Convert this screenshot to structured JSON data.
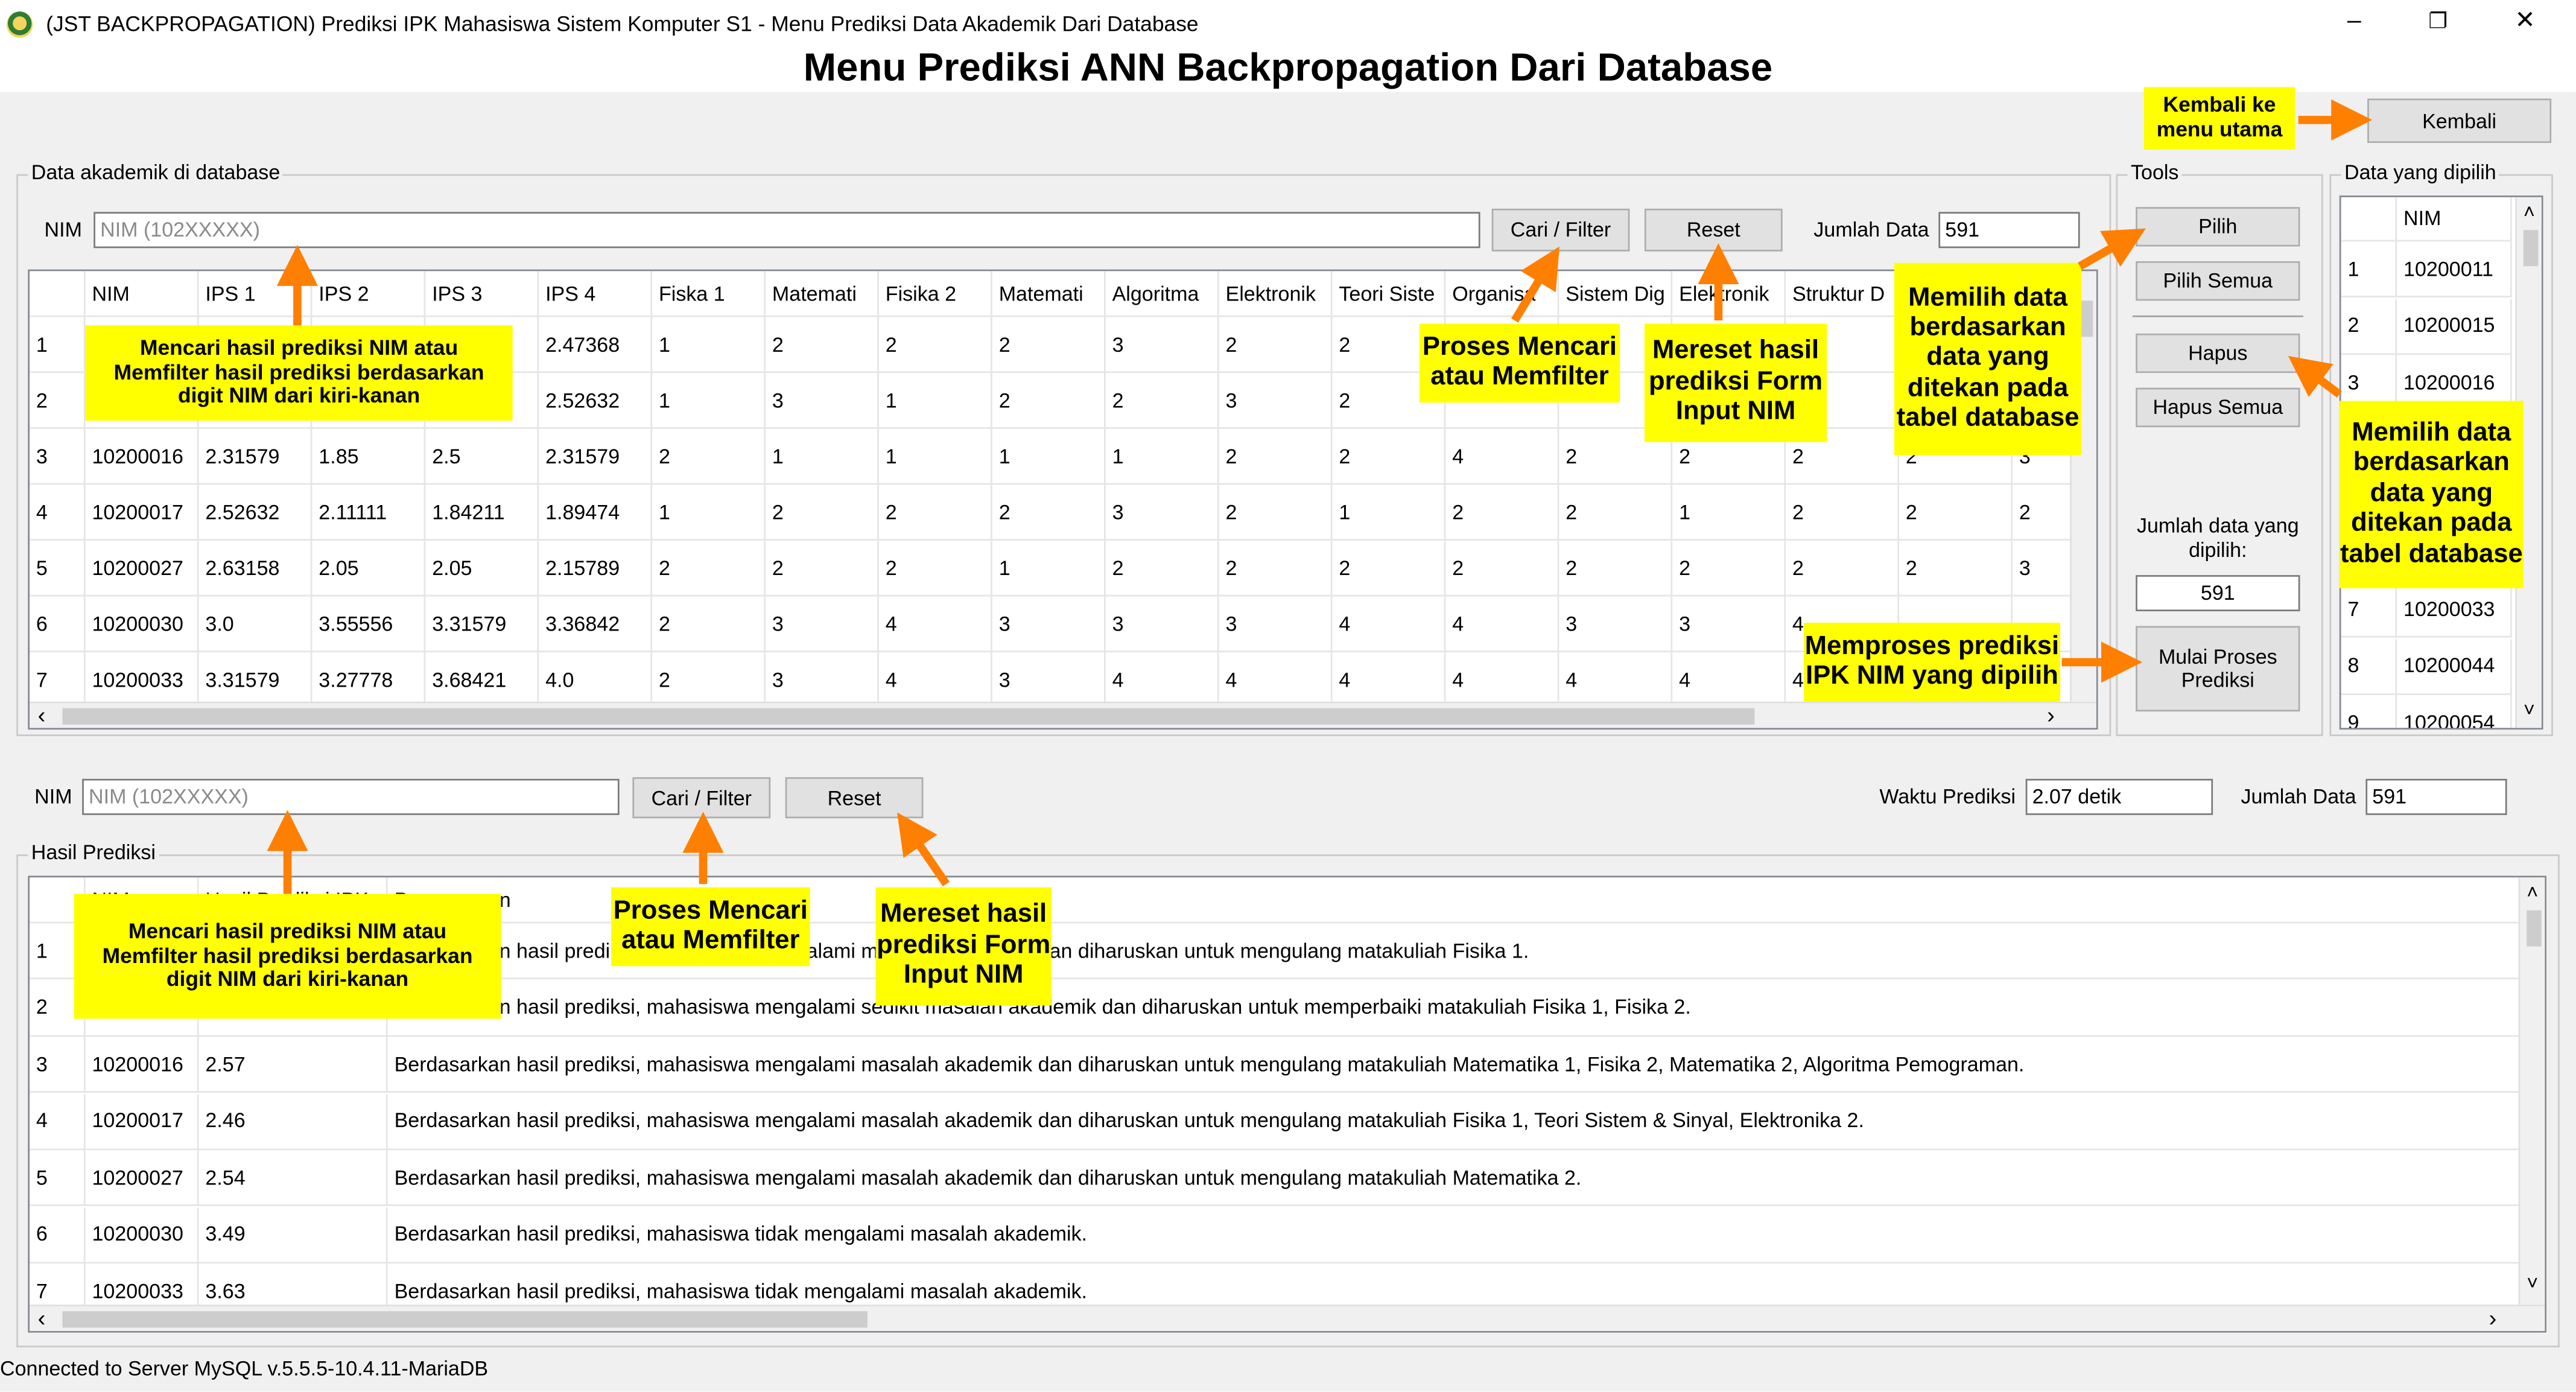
{
  "window": {
    "title": "(JST BACKPROPAGATION) Prediksi IPK Mahasiswa Sistem Komputer S1 - Menu Prediksi Data Akademik Dari Database",
    "minimize": "–",
    "maximize": "❐",
    "close": "✕"
  },
  "heading": "Menu Prediksi ANN Backpropagation Dari Database",
  "kembali": "Kembali",
  "top_panel": {
    "group_label": "Data akademik di database",
    "nim_label": "NIM",
    "nim_placeholder": "NIM (102XXXXX)",
    "search_button": "Cari / Filter",
    "reset_button": "Reset",
    "jumlah_label": "Jumlah Data",
    "jumlah_value": "591",
    "columns": [
      "NIM",
      "IPS 1",
      "IPS 2",
      "IPS 3",
      "IPS 4",
      "Fiska 1",
      "Matemati",
      "Fisika 2",
      "Matemati",
      "Algoritma",
      "Elektronik",
      "Teori Siste",
      "Organisa",
      "Sistem Dig",
      "Elektronik",
      "Struktur D",
      "",
      ""
    ],
    "rows": [
      {
        "idx": "1",
        "cells": [
          "",
          "",
          "",
          "",
          "2.47368",
          "1",
          "2",
          "2",
          "2",
          "3",
          "2",
          "2",
          "",
          "",
          "",
          "",
          "",
          ""
        ]
      },
      {
        "idx": "2",
        "cells": [
          "",
          "",
          "",
          "",
          "2.52632",
          "1",
          "3",
          "1",
          "2",
          "2",
          "3",
          "2",
          "",
          "",
          "",
          "",
          "",
          ""
        ]
      },
      {
        "idx": "3",
        "cells": [
          "10200016",
          "2.31579",
          "1.85",
          "2.5",
          "2.31579",
          "2",
          "1",
          "1",
          "1",
          "1",
          "2",
          "2",
          "4",
          "2",
          "2",
          "2",
          "2",
          "3"
        ]
      },
      {
        "idx": "4",
        "cells": [
          "10200017",
          "2.52632",
          "2.11111",
          "1.84211",
          "1.89474",
          "1",
          "2",
          "2",
          "2",
          "3",
          "2",
          "1",
          "2",
          "2",
          "1",
          "2",
          "2",
          "2"
        ]
      },
      {
        "idx": "5",
        "cells": [
          "10200027",
          "2.63158",
          "2.05",
          "2.05",
          "2.15789",
          "2",
          "2",
          "2",
          "1",
          "2",
          "2",
          "2",
          "2",
          "2",
          "2",
          "2",
          "2",
          "3"
        ]
      },
      {
        "idx": "6",
        "cells": [
          "10200030",
          "3.0",
          "3.55556",
          "3.31579",
          "3.36842",
          "2",
          "3",
          "4",
          "3",
          "3",
          "3",
          "4",
          "4",
          "3",
          "3",
          "4",
          "",
          ""
        ]
      },
      {
        "idx": "7",
        "cells": [
          "10200033",
          "3.31579",
          "3.27778",
          "3.68421",
          "4.0",
          "2",
          "3",
          "4",
          "3",
          "4",
          "4",
          "4",
          "4",
          "4",
          "4",
          "4",
          "",
          ""
        ]
      }
    ]
  },
  "tools": {
    "group_label": "Tools",
    "pilih": "Pilih",
    "pilih_semua": "Pilih Semua",
    "hapus": "Hapus",
    "hapus_semua": "Hapus Semua",
    "jumlah_label": "Jumlah data yang dipilih:",
    "jumlah_value": "591",
    "mulai": "Mulai Proses Prediksi"
  },
  "selected": {
    "group_label": "Data yang dipilih",
    "header": "NIM",
    "rows": [
      {
        "idx": "1",
        "nim": "10200011"
      },
      {
        "idx": "2",
        "nim": "10200015"
      },
      {
        "idx": "3",
        "nim": "10200016"
      },
      {
        "idx": "",
        "nim": ""
      },
      {
        "idx": "",
        "nim": ""
      },
      {
        "idx": "",
        "nim": ""
      },
      {
        "idx": "7",
        "nim": "10200033"
      },
      {
        "idx": "8",
        "nim": "10200044"
      },
      {
        "idx": "9",
        "nim": "10200054"
      }
    ]
  },
  "bottom_panel": {
    "nim_label": "NIM",
    "nim_placeholder": "NIM (102XXXXX)",
    "search_button": "Cari / Filter",
    "reset_button": "Reset",
    "waktu_label": "Waktu Prediksi",
    "waktu_value": "2.07 detik",
    "jumlah_label": "Jumlah Data",
    "jumlah_value": "591",
    "group_label": "Hasil Prediksi",
    "columns": [
      "NIM",
      "Hasil Prediksi IPK",
      "Penanganan"
    ],
    "rows": [
      {
        "idx": "1",
        "nim": "",
        "ipk": "",
        "text": "Berdasarkan hasil prediksi, mahasiswa mengalami masalah akademik dan diharuskan untuk mengulang matakuliah Fisika 1."
      },
      {
        "idx": "2",
        "nim": "",
        "ipk": "",
        "text": "Berdasarkan hasil prediksi, mahasiswa mengalami sedikit masalah akademik dan diharuskan untuk memperbaiki matakuliah Fisika 1, Fisika 2."
      },
      {
        "idx": "3",
        "nim": "10200016",
        "ipk": "2.57",
        "text": "Berdasarkan hasil prediksi, mahasiswa mengalami masalah akademik dan diharuskan untuk mengulang matakuliah Matematika 1, Fisika 2, Matematika 2, Algoritma Pemograman."
      },
      {
        "idx": "4",
        "nim": "10200017",
        "ipk": "2.46",
        "text": "Berdasarkan hasil prediksi, mahasiswa mengalami masalah akademik dan diharuskan untuk mengulang matakuliah Fisika 1, Teori Sistem & Sinyal, Elektronika 2."
      },
      {
        "idx": "5",
        "nim": "10200027",
        "ipk": "2.54",
        "text": "Berdasarkan hasil prediksi, mahasiswa mengalami masalah akademik dan diharuskan untuk mengulang matakuliah Matematika 2."
      },
      {
        "idx": "6",
        "nim": "10200030",
        "ipk": "3.49",
        "text": "Berdasarkan hasil prediksi, mahasiswa tidak mengalami masalah akademik."
      },
      {
        "idx": "7",
        "nim": "10200033",
        "ipk": "3.63",
        "text": "Berdasarkan hasil prediksi, mahasiswa tidak mengalami masalah akademik."
      }
    ]
  },
  "status": "Connected to Server MySQL v.5.5.5-10.4.11-MariaDB",
  "callouts": {
    "kembali": "Kembali ke menu utama",
    "top_search_input": "Mencari hasil prediksi NIM atau Memfilter hasil prediksi berdasarkan digit NIM dari kiri-kanan",
    "top_search_btn": "Proses Mencari atau Memfilter",
    "top_reset": "Mereset hasil prediksi Form Input NIM",
    "pilih": "Memilih data berdasarkan data yang ditekan pada tabel database",
    "hapus": "Memilih data berdasarkan data yang ditekan pada tabel database",
    "mulai": "Memproses prediksi IPK NIM yang dipilih",
    "bottom_search_input": "Mencari hasil prediksi NIM atau Memfilter hasil prediksi berdasarkan digit NIM dari kiri-kanan",
    "bottom_search_btn": "Proses Mencari atau Memfilter",
    "bottom_reset": "Mereset hasil prediksi Form Input NIM"
  },
  "colors": {
    "callout_bg": "#ffff00",
    "arrow": "#ff7f00"
  }
}
